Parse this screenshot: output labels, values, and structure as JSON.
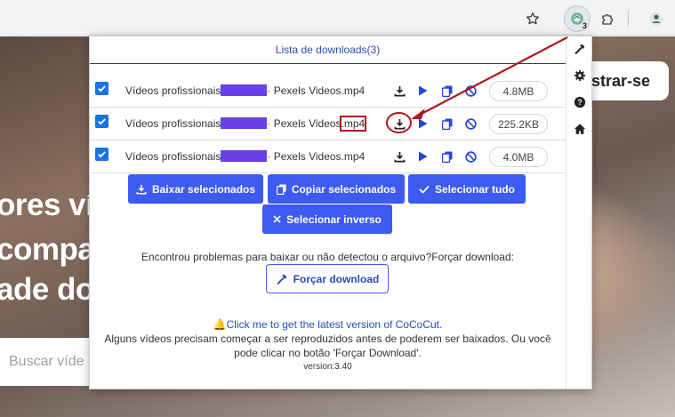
{
  "background": {
    "headline_lines": [
      "ores víd",
      "compa",
      "ade do"
    ],
    "register_label": "istrar-se",
    "search_placeholder": "Buscar víde"
  },
  "toolbar": {
    "extension_badge": "3"
  },
  "popup": {
    "title": "Lista de downloads(3)",
    "rows": [
      {
        "name_prefix": "Vídeos profissionais",
        "name_suffix": "· Pexels Videos",
        "ext": ".mp4",
        "size": "4.8MB",
        "checked": true
      },
      {
        "name_prefix": "Vídeos profissionais",
        "name_suffix": "· Pexels Videos",
        "ext": ".mp4",
        "size": "225.2KB",
        "checked": true
      },
      {
        "name_prefix": "Vídeos profissionais",
        "name_suffix": "· Pexels Videos",
        "ext": ".mp4",
        "size": "4.0MB",
        "checked": true
      }
    ],
    "buttons": {
      "download_selected": "Baixar selecionados",
      "copy_selected": "Copiar selecionados",
      "select_all": "Selecionar tudo",
      "select_inverse": "Selecionar inverso",
      "force_download": "Forçar download"
    },
    "problem_text": "Encontrou problemas para baixar ou não detectou o arquivo?Forçar download:",
    "footer": {
      "link": "Click me to get the latest version of CoCoCut.",
      "note_line1": "Alguns vídeos precisam começar a ser reproduzidos antes de poderem ser baixados. Ou você",
      "note_line2": "pode clicar no botão 'Forçar Download'.",
      "version": "version:3.40"
    }
  },
  "colors": {
    "accent": "#3d5af1",
    "title": "#2a4bb8",
    "annotation": "#b0161e",
    "redaction": "#6a3fe8"
  }
}
